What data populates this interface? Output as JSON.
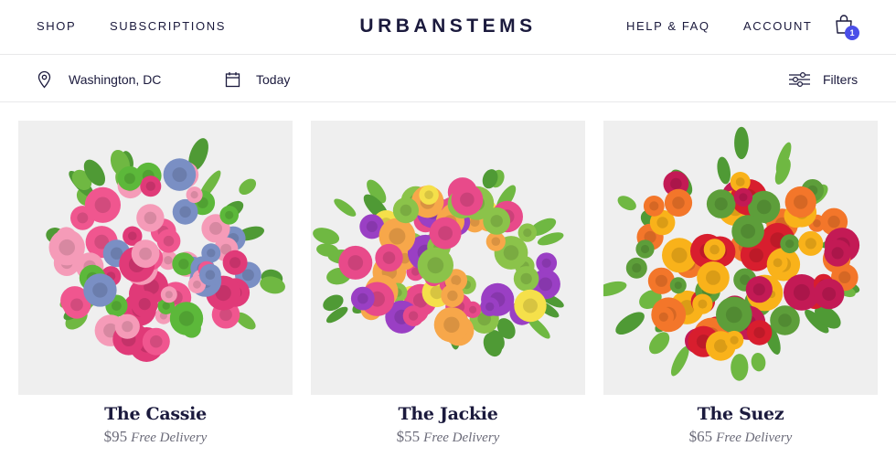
{
  "nav": {
    "shop": "SHOP",
    "subscriptions": "SUBSCRIPTIONS",
    "logo": "URBANSTEMS",
    "help": "HELP & FAQ",
    "account": "ACCOUNT",
    "cart_count": "1",
    "cart_icon": "shopping-bag-icon"
  },
  "filters": {
    "location": "Washington, DC",
    "location_icon": "map-pin-icon",
    "date": "Today",
    "date_icon": "calendar-icon",
    "filters_label": "Filters",
    "filters_icon": "sliders-icon"
  },
  "products": [
    {
      "name": "The Cassie",
      "price": "$95",
      "delivery": "Free Delivery",
      "palette": [
        "#f0568f",
        "#f59bb8",
        "#e03a78",
        "#7a8fc4",
        "#5cb83a"
      ]
    },
    {
      "name": "The Jackie",
      "price": "$55",
      "delivery": "Free Delivery",
      "palette": [
        "#9a3fc4",
        "#f7a74a",
        "#8bc34a",
        "#e84a8a",
        "#f5e04a"
      ]
    },
    {
      "name": "The Suez",
      "price": "$65",
      "delivery": "Free Delivery",
      "palette": [
        "#d81e2e",
        "#f9b21a",
        "#f3762a",
        "#c31a55",
        "#5d9e3a"
      ]
    }
  ],
  "colors": {
    "text": "#1b1a3d",
    "badge": "#4a4ee8",
    "muted": "#6a6a78",
    "image_bg": "#efefef"
  }
}
